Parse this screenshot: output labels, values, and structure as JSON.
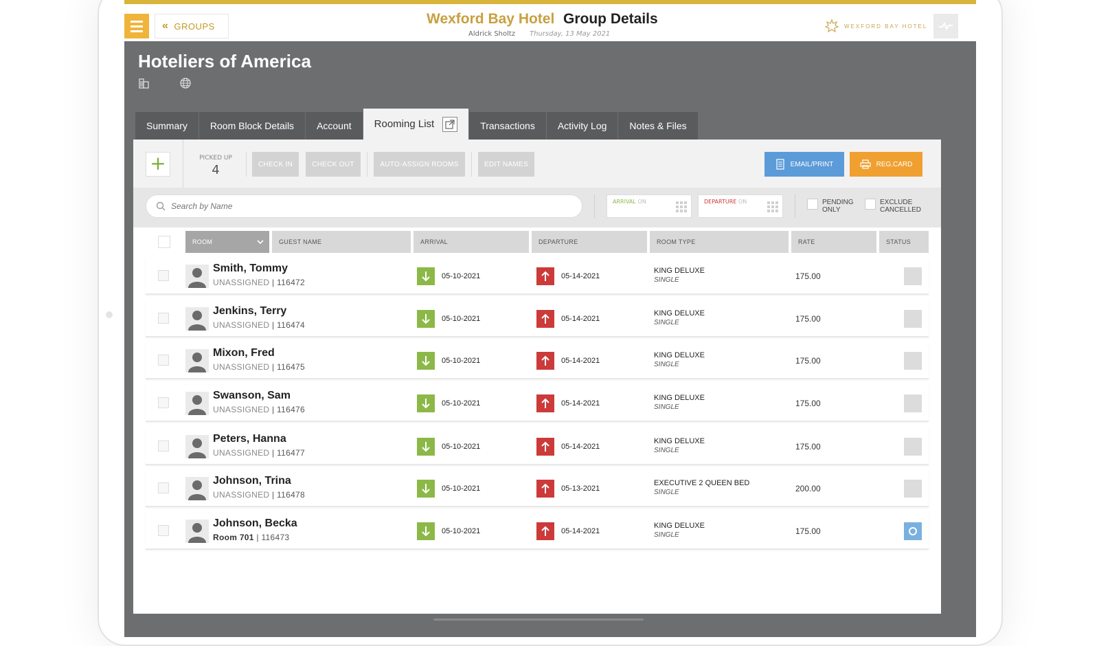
{
  "header": {
    "groups_label": "GROUPS",
    "brand": "Wexford Bay Hotel",
    "page_title": "Group Details",
    "user": "Aldrick Sholtz",
    "date": "Thursday, 13 May 2021",
    "hotel_logo_text": "WEXFORD BAY HOTEL",
    "accent": "#d8b43a"
  },
  "group": {
    "name": "Hoteliers of America"
  },
  "tabs": [
    {
      "label": "Summary"
    },
    {
      "label": "Room Block Details"
    },
    {
      "label": "Account"
    },
    {
      "label": "Rooming List",
      "active": true
    },
    {
      "label": "Transactions"
    },
    {
      "label": "Activity Log"
    },
    {
      "label": "Notes & Files"
    }
  ],
  "toolbar": {
    "picked_up_label": "PICKED UP",
    "picked_up_value": "4",
    "check_in": "CHECK IN",
    "check_out": "CHECK OUT",
    "auto_assign": "AUTO-ASSIGN ROOMS",
    "edit_names": "EDIT NAMES",
    "email_print": "EMAIL/PRINT",
    "reg_card": "REG.CARD"
  },
  "filters": {
    "search_placeholder": "Search by Name",
    "arrival_label": "ARRIVAL",
    "arrival_on": "ON",
    "departure_label": "DEPARTURE",
    "departure_on": "ON",
    "pending_only": "PENDING ONLY",
    "pending_1": "PENDING",
    "pending_2": "ONLY",
    "exclude_1": "EXCLUDE",
    "exclude_2": "CANCELLED"
  },
  "columns": {
    "room": "ROOM",
    "guest_name": "GUEST NAME",
    "arrival": "ARRIVAL",
    "departure": "DEPARTURE",
    "room_type": "ROOM TYPE",
    "rate": "RATE",
    "status": "STATUS"
  },
  "rows": [
    {
      "name": "Smith, Tommy",
      "room": "UNASSIGNED",
      "conf": "116472",
      "arrival": "05-10-2021",
      "departure": "05-14-2021",
      "room_type": "KING DELUXE",
      "occupancy": "SINGLE",
      "rate": "175.00"
    },
    {
      "name": "Jenkins, Terry",
      "room": "UNASSIGNED",
      "conf": "116474",
      "arrival": "05-10-2021",
      "departure": "05-14-2021",
      "room_type": "KING DELUXE",
      "occupancy": "SINGLE",
      "rate": "175.00"
    },
    {
      "name": "Mixon, Fred",
      "room": "UNASSIGNED",
      "conf": "116475",
      "arrival": "05-10-2021",
      "departure": "05-14-2021",
      "room_type": "KING DELUXE",
      "occupancy": "SINGLE",
      "rate": "175.00"
    },
    {
      "name": "Swanson, Sam",
      "room": "UNASSIGNED",
      "conf": "116476",
      "arrival": "05-10-2021",
      "departure": "05-14-2021",
      "room_type": "KING DELUXE",
      "occupancy": "SINGLE",
      "rate": "175.00"
    },
    {
      "name": "Peters, Hanna",
      "room": "UNASSIGNED",
      "conf": "116477",
      "arrival": "05-10-2021",
      "departure": "05-14-2021",
      "room_type": "KING DELUXE",
      "occupancy": "SINGLE",
      "rate": "175.00"
    },
    {
      "name": "Johnson, Trina",
      "room": "UNASSIGNED",
      "conf": "116478",
      "arrival": "05-10-2021",
      "departure": "05-13-2021",
      "room_type": "EXECUTIVE 2 QUEEN BED",
      "occupancy": "SINGLE",
      "rate": "200.00"
    },
    {
      "name": "Johnson, Becka",
      "room": "Room 701",
      "conf": "116473",
      "arrival": "05-10-2021",
      "departure": "05-14-2021",
      "room_type": "KING DELUXE",
      "occupancy": "SINGLE",
      "rate": "175.00",
      "checked_in": true
    }
  ]
}
